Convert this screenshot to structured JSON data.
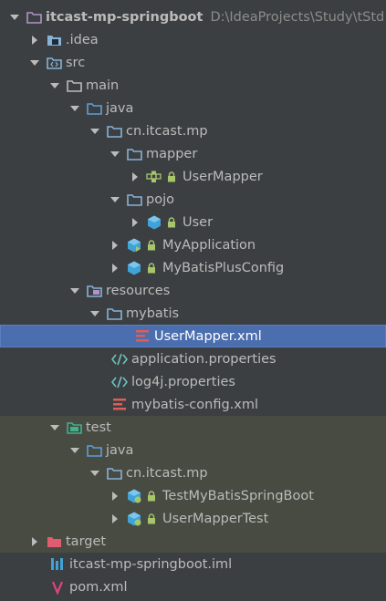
{
  "project_tree": {
    "root": {
      "label": "itcast-mp-springboot",
      "path": "D:\\IdeaProjects\\Study\\tStd"
    },
    "idea": {
      "label": ".idea"
    },
    "src": {
      "label": "src"
    },
    "main": {
      "label": "main"
    },
    "main_java": {
      "label": "java"
    },
    "main_package": {
      "label": "cn.itcast.mp"
    },
    "mapper_pkg": {
      "label": "mapper"
    },
    "user_mapper": {
      "label": "UserMapper"
    },
    "pojo_pkg": {
      "label": "pojo"
    },
    "user": {
      "label": "User"
    },
    "my_application": {
      "label": "MyApplication"
    },
    "mybatis_plus_config": {
      "label": "MyBatisPlusConfig"
    },
    "resources": {
      "label": "resources"
    },
    "mybatis_dir": {
      "label": "mybatis"
    },
    "user_mapper_xml": {
      "label": "UserMapper.xml"
    },
    "application_properties": {
      "label": "application.properties"
    },
    "log4j_properties": {
      "label": "log4j.properties"
    },
    "mybatis_config": {
      "label": "mybatis-config.xml"
    },
    "test": {
      "label": "test"
    },
    "test_java": {
      "label": "java"
    },
    "test_package": {
      "label": "cn.itcast.mp"
    },
    "test_mybatis_spring_boot": {
      "label": "TestMyBatisSpringBoot"
    },
    "user_mapper_test": {
      "label": "UserMapperTest"
    },
    "target": {
      "label": "target"
    },
    "iml": {
      "label": "itcast-mp-springboot.iml"
    },
    "pom": {
      "label": "pom.xml"
    }
  },
  "colors": {
    "background": "#3c3f41",
    "selection": "#4b6eaf",
    "test_highlight": "#474b42",
    "folder_blue": "#87b2d8",
    "folder_source": "#5e9fd6",
    "folder_test": "#40b08d",
    "folder_target": "#e05d6f",
    "java_class": "#3fa3d7",
    "lock_green": "#a7c66a",
    "xml_red": "#e05d55"
  }
}
